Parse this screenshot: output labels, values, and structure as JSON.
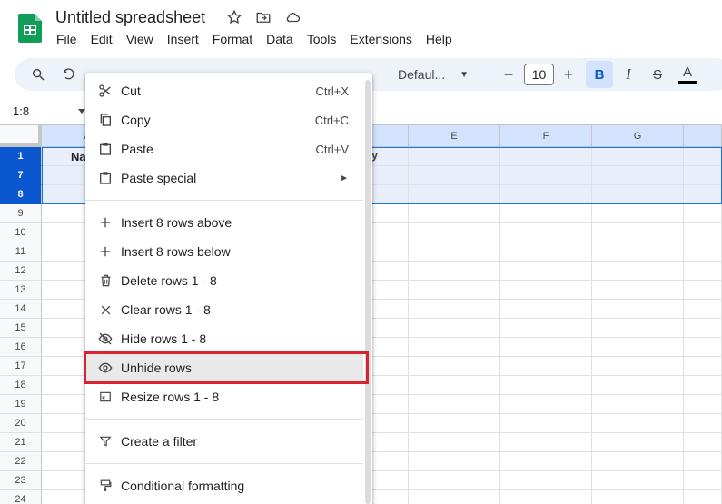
{
  "app": {
    "doc_title": "Untitled spreadsheet",
    "menu": [
      "File",
      "Edit",
      "View",
      "Insert",
      "Format",
      "Data",
      "Tools",
      "Extensions",
      "Help"
    ]
  },
  "toolbar": {
    "font_name": "Defaul...",
    "font_size": "10",
    "minus": "−",
    "plus": "+",
    "bold": "B",
    "italic": "I",
    "strike": "S",
    "text_color_letter": "A"
  },
  "name_box": "1:8",
  "columns": [
    "A",
    "",
    "",
    "",
    "E",
    "F",
    "G",
    ""
  ],
  "rows": [
    "1",
    "7",
    "8",
    "9",
    "10",
    "11",
    "12",
    "13",
    "14",
    "15",
    "16",
    "17",
    "18",
    "19",
    "20",
    "21",
    "22",
    "23",
    "24"
  ],
  "cells": {
    "a1": "Na",
    "d1": "y"
  },
  "context_menu": {
    "items": [
      {
        "icon": "scissors-icon",
        "label": "Cut",
        "shortcut": "Ctrl+X"
      },
      {
        "icon": "copy-icon",
        "label": "Copy",
        "shortcut": "Ctrl+C"
      },
      {
        "icon": "clipboard-icon",
        "label": "Paste",
        "shortcut": "Ctrl+V"
      },
      {
        "icon": "clipboard-icon",
        "label": "Paste special",
        "shortcut": "►"
      },
      {
        "icon": "plus-icon",
        "label": "Insert 8 rows above",
        "shortcut": ""
      },
      {
        "icon": "plus-icon",
        "label": "Insert 8 rows below",
        "shortcut": ""
      },
      {
        "icon": "trash-icon",
        "label": "Delete rows 1 - 8",
        "shortcut": ""
      },
      {
        "icon": "close-icon",
        "label": "Clear rows 1 - 8",
        "shortcut": ""
      },
      {
        "icon": "eye-off-icon",
        "label": "Hide rows 1 - 8",
        "shortcut": ""
      },
      {
        "icon": "eye-icon",
        "label": "Unhide rows",
        "shortcut": ""
      },
      {
        "icon": "resize-icon",
        "label": "Resize rows 1 - 8",
        "shortcut": ""
      },
      {
        "icon": "filter-icon",
        "label": "Create a filter",
        "shortcut": ""
      },
      {
        "icon": "paint-roller-icon",
        "label": "Conditional formatting",
        "shortcut": ""
      }
    ]
  },
  "colors": {
    "accent": "#0b57d0",
    "highlight_border": "#d9232e",
    "sheets_green": "#0f9d58"
  }
}
